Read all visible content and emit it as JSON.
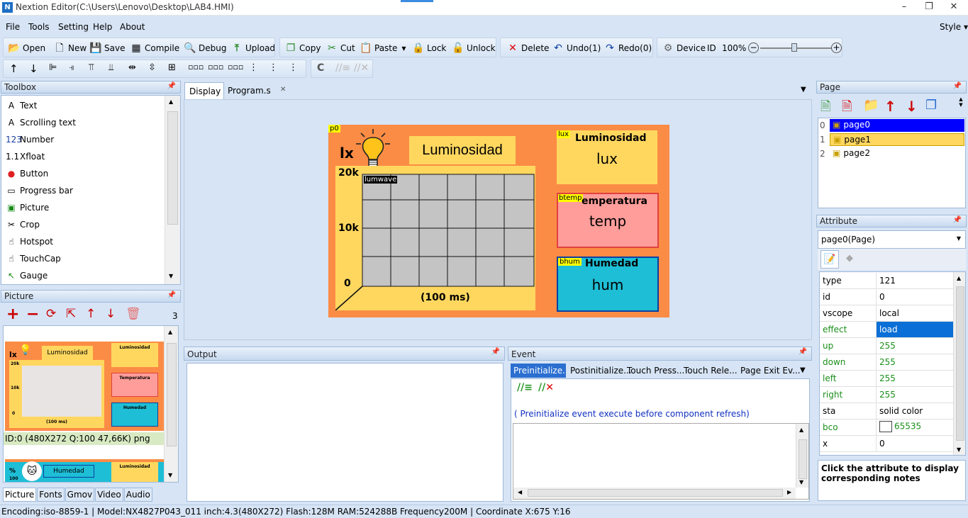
{
  "window": {
    "title": "Nextion Editor(C:\\Users\\Lenovo\\Desktop\\LAB4.HMI)",
    "min": "–",
    "max": "❐",
    "close": "✕"
  },
  "menu": {
    "items": [
      "File",
      "Tools",
      "Setting",
      "Help",
      "About"
    ],
    "style": "Style"
  },
  "toolbar1": {
    "open": "Open",
    "new": "New",
    "save": "Save",
    "compile": "Compile",
    "debug": "Debug",
    "upload": "Upload"
  },
  "toolbar2": {
    "copy": "Copy",
    "cut": "Cut",
    "paste": "Paste",
    "lock": "Lock",
    "unlock": "Unlock"
  },
  "toolbar3": {
    "delete": "Delete",
    "undo": "Undo(1)",
    "redo": "Redo(0)"
  },
  "toolbar4": {
    "device": "Device",
    "id": "ID",
    "zoom": "100%"
  },
  "toolbox": {
    "title": "Toolbox",
    "items": [
      "Text",
      "Scrolling text",
      "Number",
      "Xfloat",
      "Button",
      "Progress bar",
      "Picture",
      "Crop",
      "Hotspot",
      "TouchCap",
      "Gauge"
    ],
    "icons": [
      "A",
      "A",
      "123",
      "1.1",
      "●",
      "▭",
      "▣",
      "✂",
      "☝",
      "☝",
      "↖"
    ]
  },
  "picture": {
    "title": "Picture",
    "count": "3",
    "info": "ID:0  (480X272 Q:100 47,66K) png",
    "thumb1": {
      "lx": "lx",
      "lum": "Luminosidad",
      "lum2": "Luminosidad",
      "temp": "Temperatura",
      "hum": "Humedad",
      "t20k": "20k",
      "t10k": "10k",
      "t0": "0",
      "xl": "(100 ms)"
    },
    "thumb2": {
      "pct": "%",
      "hum": "Humedad",
      "lum": "Luminosidad",
      "t100": "100"
    }
  },
  "bottom_tabs": [
    "Picture",
    "Fonts",
    "Gmov",
    "Video",
    "Audio"
  ],
  "editor_tabs": {
    "display": "Display",
    "program": "Program.s",
    "close": "✕"
  },
  "canvas": {
    "page_label": "p0",
    "lx": "lx",
    "title_box": "Luminosidad",
    "y20k": "20k",
    "y10k": "10k",
    "y0": "0",
    "wave_label": "lumwave",
    "xlabel": "(100 ms)",
    "lux": {
      "tag": "lux",
      "title": "Luminosidad",
      "value": "lux"
    },
    "temp": {
      "tag": "btemp",
      "title": "emperatura",
      "value": "temp"
    },
    "hum": {
      "tag": "bhum",
      "title": "Humedad",
      "value": "hum"
    }
  },
  "page_panel": {
    "title": "Page",
    "pages": [
      {
        "n": "0",
        "name": "page0"
      },
      {
        "n": "1",
        "name": "page1"
      },
      {
        "n": "2",
        "name": "page2"
      }
    ]
  },
  "attribute": {
    "title": "Attribute",
    "selector": "page0(Page)",
    "rows": [
      {
        "k": "type",
        "v": "121",
        "g": false
      },
      {
        "k": "id",
        "v": "0",
        "g": false
      },
      {
        "k": "vscope",
        "v": "local",
        "g": false
      },
      {
        "k": "effect",
        "v": "load",
        "g": true
      },
      {
        "k": "up",
        "v": "255",
        "g": true
      },
      {
        "k": "down",
        "v": "255",
        "g": true
      },
      {
        "k": "left",
        "v": "255",
        "g": true
      },
      {
        "k": "right",
        "v": "255",
        "g": true
      },
      {
        "k": "sta",
        "v": "solid color",
        "g": false
      },
      {
        "k": "bco",
        "v": "65535",
        "g": true
      },
      {
        "k": "x",
        "v": "0",
        "g": false
      }
    ],
    "note": "Click the attribute to display corresponding notes"
  },
  "output": {
    "title": "Output"
  },
  "event": {
    "title": "Event",
    "tabs": [
      "Preinitialize...",
      "Postinitialize...",
      "Touch Press...",
      "Touch Rele...",
      "Page Exit Ev..."
    ],
    "hint": "( Preinitialize event execute before component refresh)"
  },
  "status": {
    "text": "Encoding:iso-8859-1 | Model:NX4827P043_011  inch:4.3(480X272) Flash:128M RAM:524288B Frequency200M |    Coordinate X:675  Y:16"
  },
  "colors": {
    "canvas_bg": "#fb8c45",
    "yellow": "#ffd75f",
    "pink": "#ff9d9a",
    "cyan": "#1ebed6",
    "grid": "#c4c4c4",
    "select": "#0a6fd6"
  }
}
